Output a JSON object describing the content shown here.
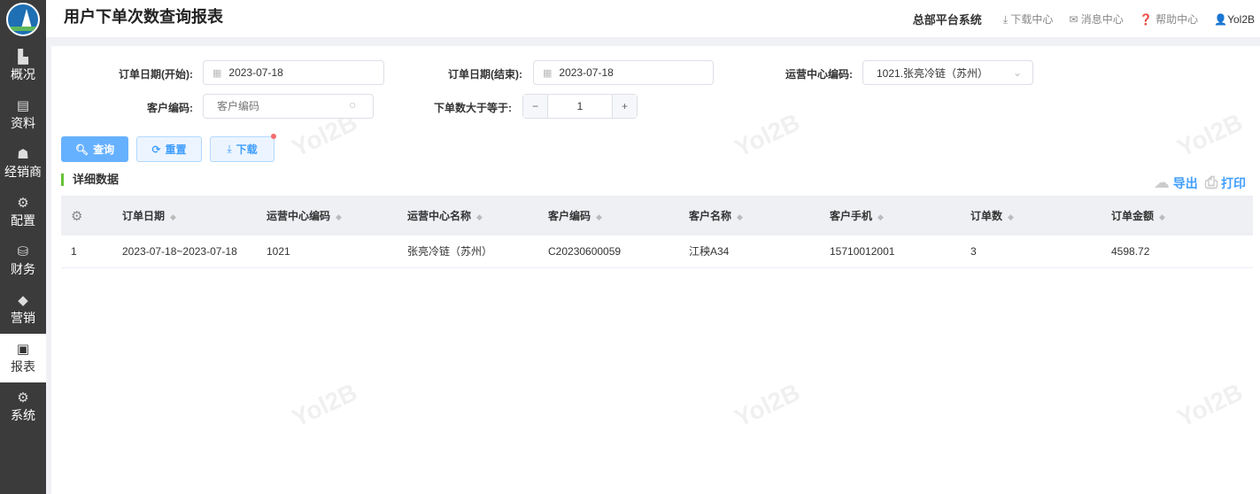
{
  "sidebar": {
    "items": [
      {
        "label": "概况",
        "icon": "building-icon"
      },
      {
        "label": "资料",
        "icon": "document-icon"
      },
      {
        "label": "经销商",
        "icon": "dealer-icon"
      },
      {
        "label": "配置",
        "icon": "config-icon"
      },
      {
        "label": "财务",
        "icon": "finance-icon"
      },
      {
        "label": "营销",
        "icon": "tag-icon"
      },
      {
        "label": "报表",
        "icon": "chart-icon",
        "active": true
      },
      {
        "label": "系统",
        "icon": "gears-icon"
      }
    ]
  },
  "header": {
    "title": "用户下单次数查询报表",
    "system": "总部平台系统",
    "download_center": "下载中心",
    "message_center": "消息中心",
    "help_center": "帮助中心",
    "user": "Yol2B"
  },
  "filters": {
    "start_label": "订单日期(开始):",
    "start_value": "2023-07-18",
    "end_label": "订单日期(结束):",
    "end_value": "2023-07-18",
    "center_label": "运营中心编码:",
    "center_value": "1021.张亮冷链（苏州）",
    "customer_label": "客户编码:",
    "customer_placeholder": "客户编码",
    "count_label": "下单数大于等于:",
    "count_value": "1"
  },
  "buttons": {
    "query": "查询",
    "reset": "重置",
    "download": "下载"
  },
  "section": {
    "title": "详细数据",
    "export": "导出",
    "print": "打印"
  },
  "table": {
    "columns": [
      "订单日期",
      "运营中心编码",
      "运营中心名称",
      "客户编码",
      "客户名称",
      "客户手机",
      "订单数",
      "订单金额"
    ],
    "rows": [
      [
        "1",
        "2023-07-18~2023-07-18",
        "1021",
        "张亮冷链（苏州）",
        "C20230600059",
        "江秧A34",
        "15710012001",
        "3",
        "4598.72"
      ]
    ]
  },
  "watermark": "Yol2B"
}
